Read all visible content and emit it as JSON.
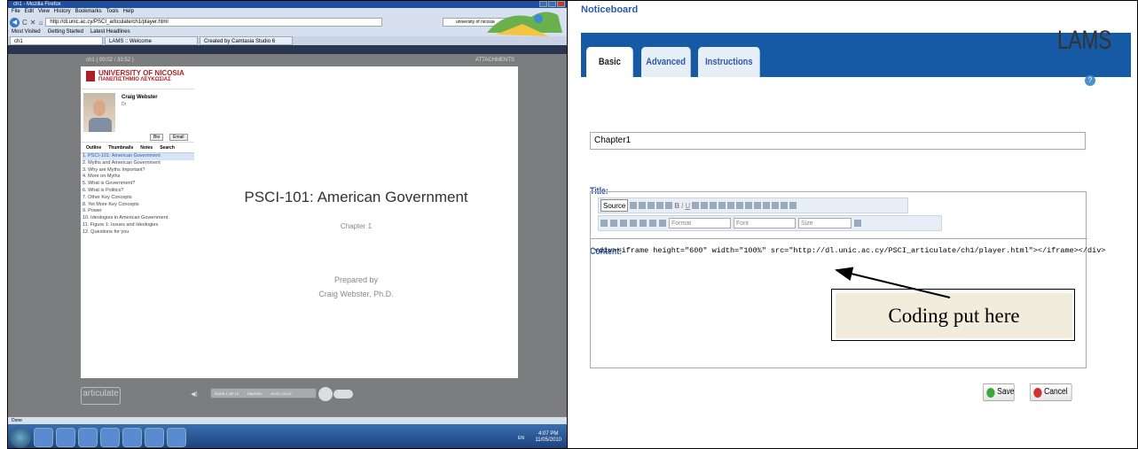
{
  "firefox": {
    "title": "ch1 - Mozilla Firefox",
    "menu": [
      "File",
      "Edit",
      "View",
      "History",
      "Bookmarks",
      "Tools",
      "Help"
    ],
    "url": "http://dl.unic.ac.cy/PSCI_articulate/ch1/player.html",
    "search": "university of nicosia",
    "bookmarks": [
      "Most Visited",
      "Getting Started",
      "Latest Headlines"
    ],
    "tabs": [
      "ch1",
      "LAMS :: Welcome",
      "Created by Camtasia Studio 6"
    ],
    "status": "Done"
  },
  "player": {
    "header": "ch1   ( 00:02 / 33:52 )",
    "attachments": "ATTACHMENTS",
    "uni1": "UNIVERSITY OF NICOSIA",
    "uni2": "ΠΑΝΕΠΙΣΤΗΜΙΟ ΛΕΥΚΩΣΙΑΣ",
    "presenter": "Craig Webster",
    "presenter_title": "Dr",
    "bio": "Bio",
    "email": "Email",
    "tabs": [
      "Outline",
      "Thumbnails",
      "Notes",
      "Search"
    ],
    "outline": [
      "1. PSCI-101: American Government",
      "2. Myths and American Government",
      "3. Why are Myths Important?",
      "4. More on Myths",
      "5. What is Government?",
      "6. What is Politics?",
      "7. Other Key Concepts",
      "8. Yet More Key Concepts",
      "9. Power",
      "10. Ideologies in American Government",
      "11. Figure 1: Issues and Ideologies",
      "12. Questions for you"
    ],
    "slide_title": "PSCI-101: American Government",
    "slide_chapter": "Chapter 1",
    "slide_prep1": "Prepared by",
    "slide_prep2": "Craig Webster, Ph.D.",
    "articulate": "articulate",
    "slide_count": "SLIDE 1 OF 12",
    "paused": "PAUSED",
    "time": "00:02 / 00:22"
  },
  "taskbar": {
    "lang": "EN",
    "time": "4:07 PM",
    "date": "11/05/2010"
  },
  "lams": {
    "panel_title": "Noticeboard",
    "logo": "LAMS",
    "tabs": [
      "Basic",
      "Advanced",
      "Instructions"
    ],
    "title_label": "Title:",
    "title_value": "Chapter1",
    "content_label": "Content:",
    "source_btn": "Source",
    "format": "Format",
    "font": "Font",
    "size": "Size",
    "code": "<div><iframe height=\"600\" width=\"100%\" src=\"http://dl.unic.ac.cy/PSCI_articulate/ch1/player.html\"></iframe></div>",
    "callout": "Coding put here",
    "save": "Save",
    "cancel": "Cancel",
    "colors": {
      "accent": "#1659a4",
      "save": "#3aa83a",
      "cancel": "#d03030"
    }
  }
}
